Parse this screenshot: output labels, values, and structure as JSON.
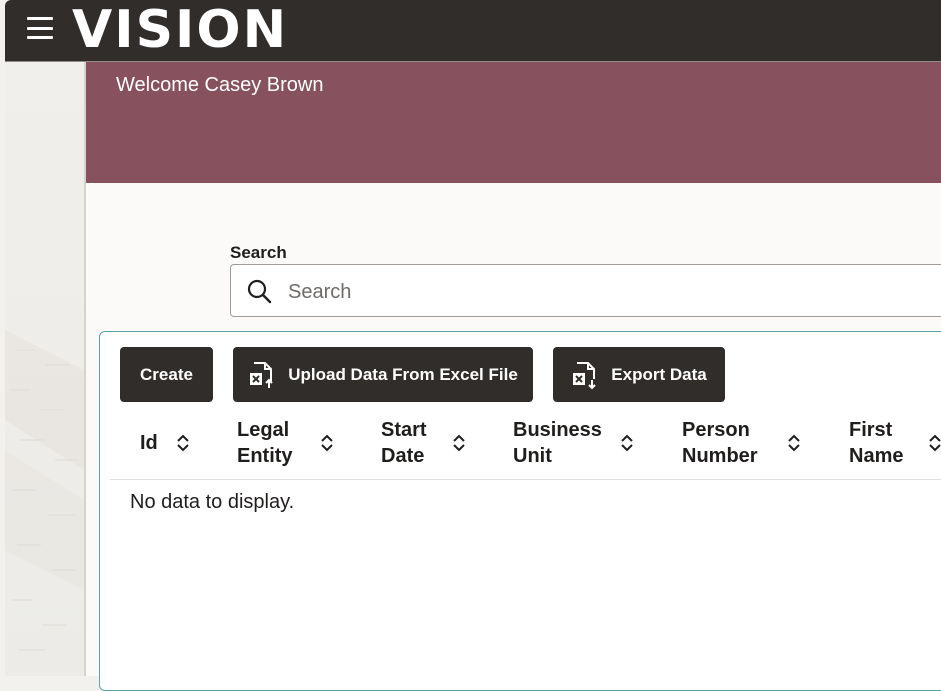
{
  "app": {
    "logo": "VISION"
  },
  "banner": {
    "welcome": "Welcome Casey Brown",
    "color": "#87525d"
  },
  "search": {
    "label": "Search",
    "placeholder": "Search",
    "value": ""
  },
  "toolbar": {
    "create_label": "Create",
    "upload_label": "Upload Data From Excel File",
    "export_label": "Export Data"
  },
  "table": {
    "columns": [
      {
        "line1": "Id",
        "line2": ""
      },
      {
        "line1": "Legal",
        "line2": "Entity"
      },
      {
        "line1": "Start",
        "line2": "Date"
      },
      {
        "line1": "Business",
        "line2": "Unit"
      },
      {
        "line1": "Person",
        "line2": "Number"
      },
      {
        "line1": "First",
        "line2": "Name"
      }
    ],
    "empty_message": "No data to display."
  },
  "colors": {
    "header": "#312d2a",
    "panel_border": "#5aa3ad",
    "button": "#312d2a"
  }
}
